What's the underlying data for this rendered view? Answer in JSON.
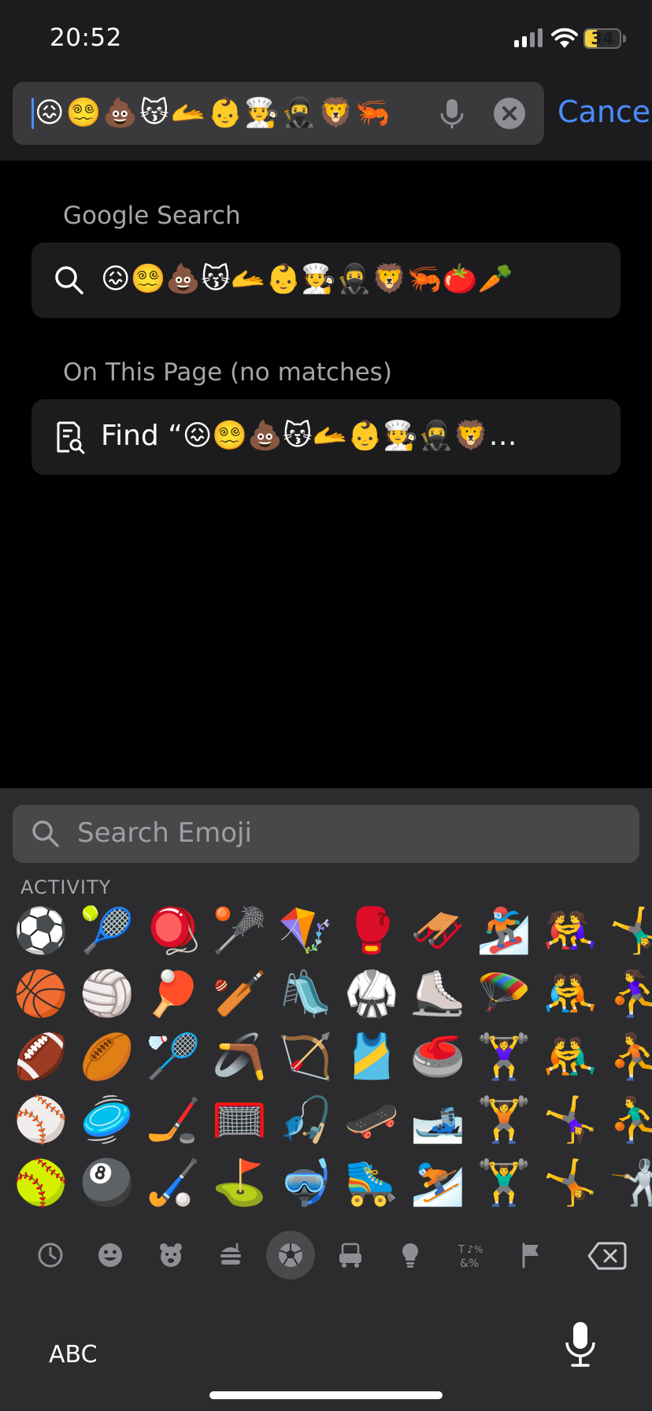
{
  "status_bar": {
    "time": "20:52",
    "battery_percent": "34",
    "battery_level": 0.34
  },
  "search_bar": {
    "query": "😖😵‍💫💩😽🫴👶🧑‍🍳🥷🦁🦐",
    "cancel_label": "Cancel"
  },
  "google_section": {
    "title": "Google Search",
    "suggestion": "😖😵‍💫💩😽🫴👶🧑‍🍳🥷🦁🦐🍅🥕"
  },
  "page_section": {
    "title": "On This Page (no matches)",
    "find_text": "Find “😖😵‍💫💩😽🫴👶🧑‍🍳🥷🦁…"
  },
  "emoji_keyboard": {
    "search_placeholder": "Search Emoji",
    "category_title": "ACTIVITY",
    "grid": [
      [
        "⚽",
        "🎾",
        "🪀",
        "🥍",
        "🪁",
        "🥊",
        "🛷",
        "🏂",
        "🤼‍♀️",
        "🤸‍♂️"
      ],
      [
        "🏀",
        "🏐",
        "🏓",
        "🏏",
        "🛝",
        "🥋",
        "⛸️",
        "🪂",
        "🤼",
        "⛹️‍♀️"
      ],
      [
        "🏈",
        "🏉",
        "🏸",
        "🪃",
        "🏹",
        "🎽",
        "🥌",
        "🏋️‍♀️",
        "🤼‍♂️",
        "⛹️"
      ],
      [
        "⚾",
        "🥏",
        "🏒",
        "🥅",
        "🎣",
        "🛹",
        "🎿",
        "🏋️",
        "🤸‍♀️",
        "⛹️‍♂️"
      ],
      [
        "🥎",
        "🎱",
        "🏑",
        "⛳",
        "🤿",
        "🛼",
        "⛷️",
        "🏋️‍♂️",
        "🤸",
        "🤺"
      ]
    ],
    "categories": [
      "recent-icon",
      "smileys-icon",
      "animals-icon",
      "food-icon",
      "activity-icon",
      "travel-icon",
      "objects-icon",
      "symbols-icon",
      "flags-icon"
    ],
    "active_category": "activity-icon",
    "abc_label": "ABC"
  },
  "colors": {
    "accent": "#4a8cff",
    "keyboard_bg": "#2c2c2e",
    "field_bg": "#3a3a3c"
  }
}
